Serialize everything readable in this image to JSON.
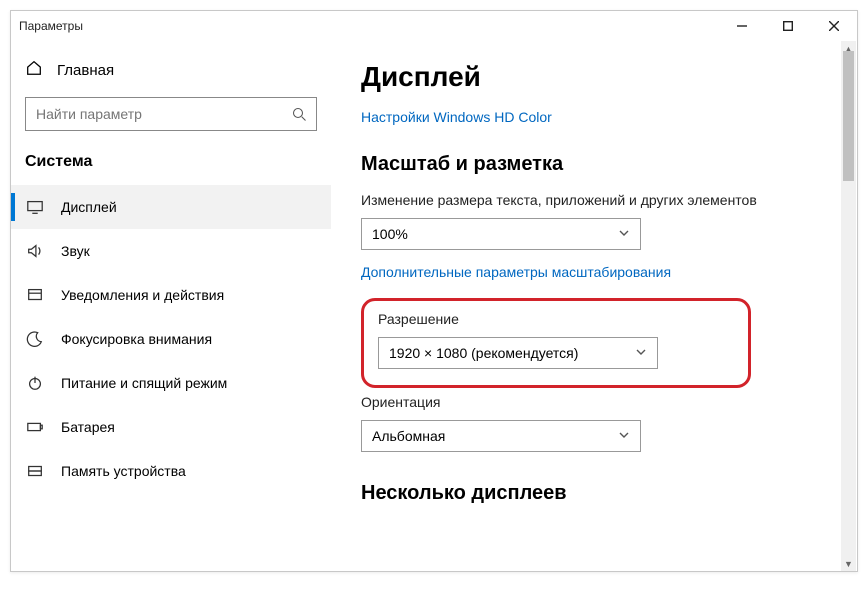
{
  "window": {
    "title": "Параметры"
  },
  "sidebar": {
    "home": "Главная",
    "search_placeholder": "Найти параметр",
    "section": "Система",
    "items": [
      {
        "label": "Дисплей"
      },
      {
        "label": "Звук"
      },
      {
        "label": "Уведомления и действия"
      },
      {
        "label": "Фокусировка внимания"
      },
      {
        "label": "Питание и спящий режим"
      },
      {
        "label": "Батарея"
      },
      {
        "label": "Память устройства"
      }
    ]
  },
  "main": {
    "title": "Дисплей",
    "hd_color_link": "Настройки Windows HD Color",
    "scale_heading": "Масштаб и разметка",
    "scale_label": "Изменение размера текста, приложений и других элементов",
    "scale_value": "100%",
    "advanced_scaling_link": "Дополнительные параметры масштабирования",
    "resolution_label": "Разрешение",
    "resolution_value": "1920 × 1080 (рекомендуется)",
    "orientation_label": "Ориентация",
    "orientation_value": "Альбомная",
    "multi_heading": "Несколько дисплеев"
  }
}
